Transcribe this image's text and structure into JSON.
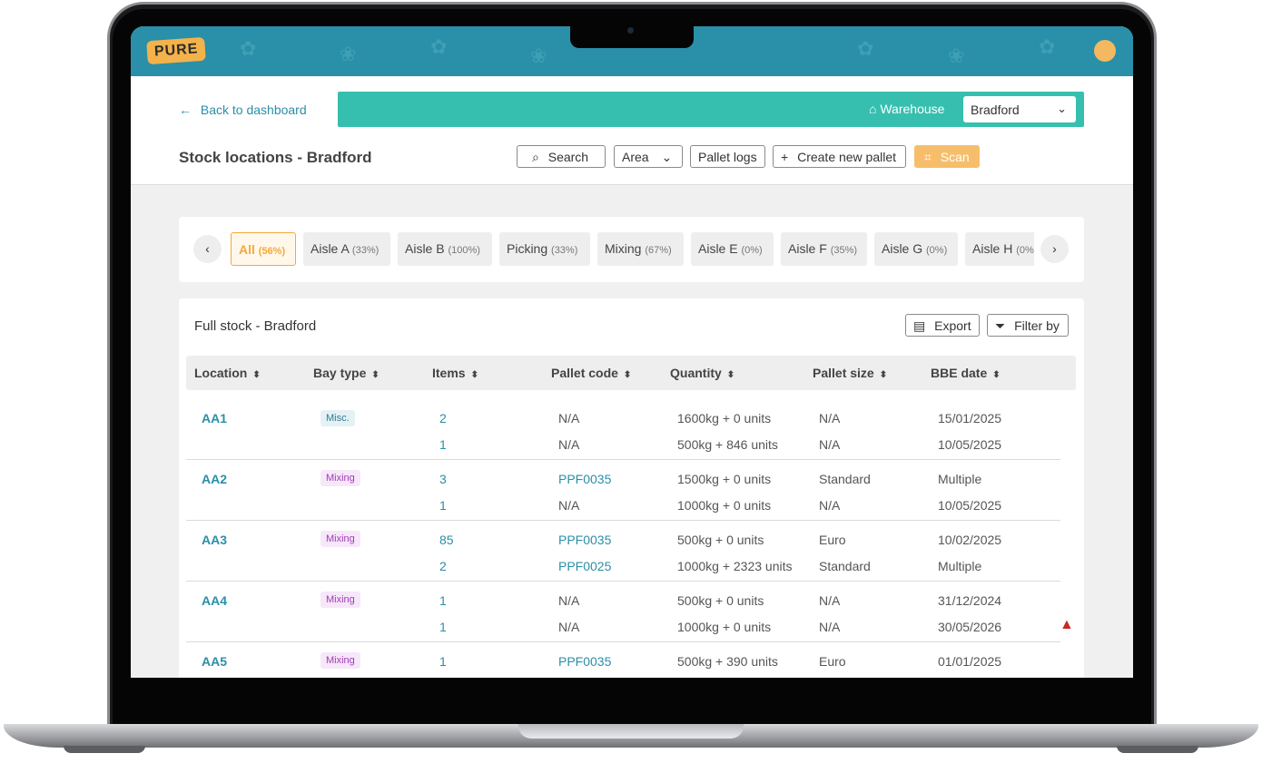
{
  "header": {
    "logo_text": "PURE"
  },
  "nav": {
    "back_label": "Back to dashboard"
  },
  "warehouse": {
    "label": "Warehouse",
    "selected": "Bradford"
  },
  "page": {
    "title": "Stock locations - Bradford"
  },
  "toolbar": {
    "search_label": "Search",
    "area_label": "Area",
    "pallet_logs_label": "Pallet logs",
    "create_label": "Create new pallet",
    "scan_label": "Scan"
  },
  "areas": [
    {
      "label": "All",
      "pct": "(56%)"
    },
    {
      "label": "Aisle A",
      "pct": "(33%)"
    },
    {
      "label": "Aisle B",
      "pct": "(100%)"
    },
    {
      "label": "Picking",
      "pct": "(33%)"
    },
    {
      "label": "Mixing",
      "pct": "(67%)"
    },
    {
      "label": "Aisle E",
      "pct": "(0%)"
    },
    {
      "label": "Aisle F",
      "pct": "(35%)"
    },
    {
      "label": "Aisle G",
      "pct": "(0%)"
    },
    {
      "label": "Aisle H",
      "pct": "(0%)"
    }
  ],
  "stock": {
    "title": "Full stock - Bradford",
    "export_label": "Export",
    "filter_label": "Filter by",
    "columns": [
      "Location",
      "Bay type",
      "Items",
      "Pallet code",
      "Quantity",
      "Pallet size",
      "BBE date"
    ]
  },
  "rows": [
    {
      "location": "AA1",
      "bay_type": "Misc.",
      "lines": [
        {
          "items": "2",
          "pallet": "N/A",
          "qty": "1600kg + 0 units",
          "size": "N/A",
          "bbe": "15/01/2025"
        },
        {
          "items": "1",
          "pallet": "N/A",
          "qty": "500kg + 846 units",
          "size": "N/A",
          "bbe": "10/05/2025"
        }
      ]
    },
    {
      "location": "AA2",
      "bay_type": "Mixing",
      "lines": [
        {
          "items": "3",
          "pallet": "PPF0035",
          "qty": "1500kg + 0 units",
          "size": "Standard",
          "bbe": "Multiple"
        },
        {
          "items": "1",
          "pallet": "N/A",
          "qty": "1000kg + 0 units",
          "size": "N/A",
          "bbe": "10/05/2025"
        }
      ]
    },
    {
      "location": "AA3",
      "bay_type": "Mixing",
      "lines": [
        {
          "items": "85",
          "pallet": "PPF0035",
          "qty": "500kg + 0 units",
          "size": "Euro",
          "bbe": "10/02/2025"
        },
        {
          "items": "2",
          "pallet": "PPF0025",
          "qty": "1000kg + 2323 units",
          "size": "Standard",
          "bbe": "Multiple"
        }
      ]
    },
    {
      "location": "AA4",
      "bay_type": "Mixing",
      "lines": [
        {
          "items": "1",
          "pallet": "N/A",
          "qty": "500kg + 0 units",
          "size": "N/A",
          "bbe": "31/12/2024"
        },
        {
          "items": "1",
          "pallet": "N/A",
          "qty": "1000kg + 0 units",
          "size": "N/A",
          "bbe": "30/05/2026"
        }
      ]
    },
    {
      "location": "AA5",
      "bay_type": "Mixing",
      "lines": [
        {
          "items": "1",
          "pallet": "PPF0035",
          "qty": "500kg + 390 units",
          "size": "Euro",
          "bbe": "01/01/2025"
        }
      ]
    }
  ],
  "colors": {
    "teal": "#2a8fa8",
    "green_bar": "#36bfae",
    "orange": "#f4a93c",
    "warning": "#c62828"
  }
}
